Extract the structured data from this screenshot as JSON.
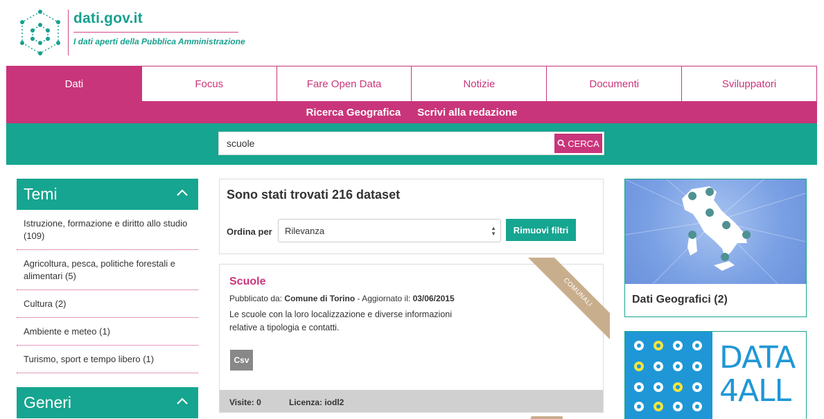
{
  "brand": {
    "title": "dati.gov.it",
    "subtitle": "I dati aperti della Pubblica Amministrazione"
  },
  "nav": {
    "tabs": [
      {
        "label": "Dati",
        "active": true
      },
      {
        "label": "Focus",
        "active": false
      },
      {
        "label": "Fare Open Data",
        "active": false
      },
      {
        "label": "Notizie",
        "active": false
      },
      {
        "label": "Documenti",
        "active": false
      },
      {
        "label": "Sviluppatori",
        "active": false
      }
    ],
    "sublinks": [
      "Ricerca Geografica",
      "Scrivi alla redazione"
    ]
  },
  "search": {
    "value": "scuole",
    "button_label": "CERCA",
    "button_icon": "search-icon"
  },
  "sidebar": {
    "temi_title": "Temi",
    "topics": [
      "Istruzione, formazione e diritto allo studio (109)",
      "Agricoltura, pesca, politiche forestali e alimentari (5)",
      "Cultura (2)",
      "Ambiente e meteo (1)",
      "Turismo, sport e tempo libero (1)"
    ],
    "generi_title": "Generi"
  },
  "results": {
    "title": "Sono stati trovati 216 dataset",
    "order_label": "Ordina per",
    "order_value": "Rilevanza",
    "remove_filters": "Rimuovi filtri"
  },
  "dataset": {
    "title": "Scuole",
    "published_by_label": "Pubblicato da:",
    "publisher": "Comune di Torino",
    "updated_label": "- Aggiornato il:",
    "updated": "03/06/2015",
    "description": "Le scuole con la loro localizzazione e diverse informazioni relative a tipologia e contatti.",
    "format": "Csv",
    "ribbon": "COMUNALI",
    "visits_label": "Visite: 0",
    "license_label": "Licenza: iodl2"
  },
  "right": {
    "geo_label": "Dati Geografici (2)",
    "d4a_line1": "DATA",
    "d4a_line2": "4ALL"
  },
  "colors": {
    "magenta": "#c9357a",
    "teal": "#16a590",
    "ribbon": "#c9ae8d",
    "d4a_blue": "#1f97d6"
  }
}
